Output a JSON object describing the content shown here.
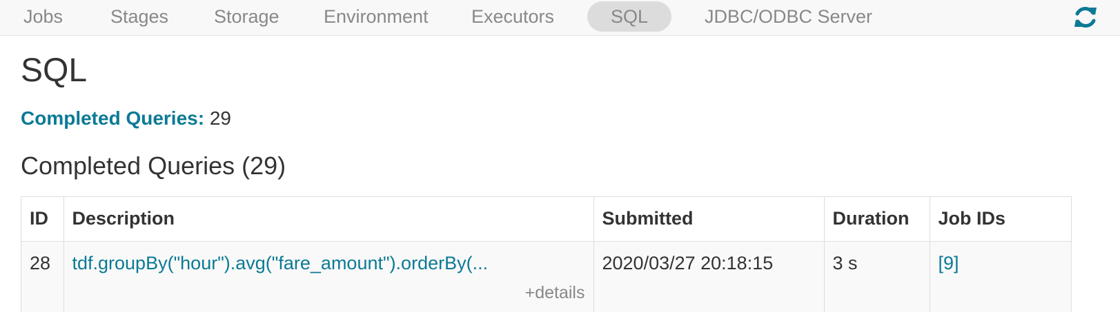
{
  "nav": {
    "tabs": [
      {
        "label": "Jobs"
      },
      {
        "label": "Stages"
      },
      {
        "label": "Storage"
      },
      {
        "label": "Environment"
      },
      {
        "label": "Executors"
      },
      {
        "label": "SQL",
        "active": true
      },
      {
        "label": "JDBC/ODBC Server"
      }
    ],
    "refresh_icon": "refresh-icon",
    "accent_color": "#0b7a95"
  },
  "page": {
    "title": "SQL",
    "summary_label": "Completed Queries:",
    "summary_value": "29",
    "section_title": "Completed Queries (29)"
  },
  "table": {
    "headers": [
      "ID",
      "Description",
      "Submitted",
      "Duration",
      "Job IDs"
    ],
    "rows": [
      {
        "id": "28",
        "description": "tdf.groupBy(\"hour\").avg(\"fare_amount\").orderBy(...",
        "details": "+details",
        "submitted": "2020/03/27 20:18:15",
        "duration": "3 s",
        "job_ids": "[9]"
      }
    ]
  }
}
